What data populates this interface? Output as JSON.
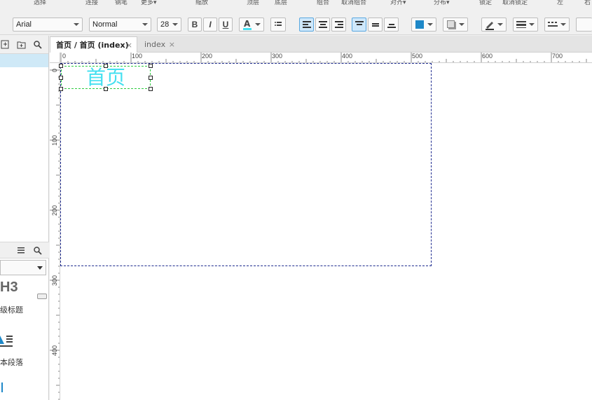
{
  "toolbar_labels": [
    "选择",
    "连接",
    "钢笔",
    "更多▾",
    "缩放",
    "顶层",
    "底层",
    "组合",
    "取消组合",
    "对齐▾",
    "分布▾",
    "锁定",
    "取消锁定",
    "左",
    "右"
  ],
  "font": {
    "family": "Arial",
    "style": "Normal",
    "size": "28"
  },
  "text_color": "#45e0f0",
  "fill_color": "#1e88c8",
  "tabs": [
    {
      "label": "首页 / 首页 (index)",
      "close": "×",
      "active": true
    },
    {
      "label": "index",
      "close": "×",
      "active": false
    }
  ],
  "ruler": {
    "top": [
      "0",
      "100",
      "200",
      "300",
      "400",
      "500",
      "600",
      "700"
    ],
    "left": [
      "0",
      "100",
      "200",
      "300",
      "400"
    ]
  },
  "library": {
    "h3": "H3",
    "heading_label": "级标题",
    "paragraph_label": "本段落"
  },
  "widget_text": "首页"
}
